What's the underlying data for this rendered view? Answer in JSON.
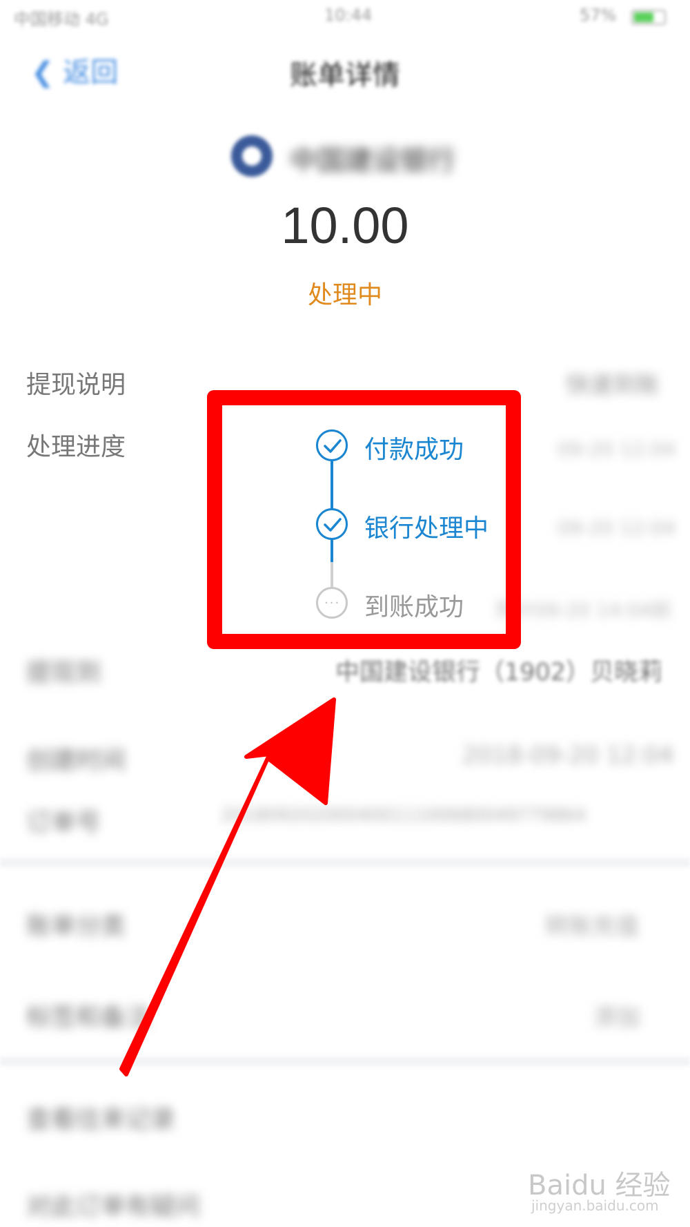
{
  "status_bar": {
    "carrier": "中国移动 4G",
    "time": "10:44",
    "battery": "57%"
  },
  "nav": {
    "back_label": "返回",
    "title": "账单详情"
  },
  "bank": {
    "name": "中国建设银行"
  },
  "amount": "10.00",
  "status": "处理中",
  "details": {
    "withdraw_label": "提现说明",
    "withdraw_value": "快速到账",
    "progress_label": "处理进度",
    "steps": [
      {
        "label": "付款成功",
        "time": "09-20 12:04",
        "state": "done"
      },
      {
        "label": "银行处理中",
        "time": "09-20 12:04",
        "state": "done"
      },
      {
        "label": "到账成功",
        "time": "预计09-20 14:04前",
        "state": "pending"
      }
    ],
    "withdraw_to_label": "提现到",
    "withdraw_to_value": "中国建设银行（1902）贝晓莉",
    "create_time_label": "创建时间",
    "create_time_value": "2018-09-20 12:04",
    "order_label": "订单号",
    "order_value": "20180920200040011100680049779864"
  },
  "menu": {
    "category_label": "账单分类",
    "category_value": "转账充值",
    "tag_label": "标签和备注",
    "tag_value": "添加",
    "other1": "查看往来记录",
    "other2": "对此订单有疑问"
  },
  "watermark": {
    "brand": "Baidu 经验",
    "url": "jingyan.baidu.com"
  },
  "colors": {
    "accent": "#1a85d0",
    "status": "#e08a1e",
    "annotation": "#ff0000"
  }
}
